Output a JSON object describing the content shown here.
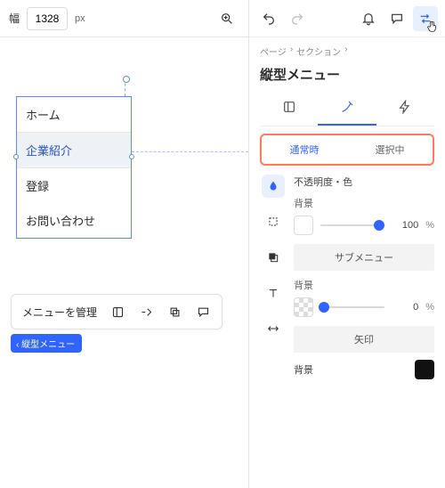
{
  "topbar": {
    "width_label": "幅",
    "width_value": "1328",
    "px": "px"
  },
  "menu": {
    "items": [
      "ホーム",
      "企業紹介",
      "登録",
      "お問い合わせ"
    ],
    "active_index": 1,
    "manage_label": "メニューを管理",
    "chip": "縦型メニュー"
  },
  "panel": {
    "breadcrumb": [
      "ページ",
      "セクション"
    ],
    "title": "縦型メニュー",
    "state_tabs": {
      "normal": "通常時",
      "selected": "選択中"
    },
    "section1_title": "不透明度・色",
    "bg_label": "背景",
    "opacity1": "100",
    "pct": "%",
    "submenu_heading": "サブメニュー",
    "opacity2": "0",
    "arrow_heading": "矢印"
  }
}
